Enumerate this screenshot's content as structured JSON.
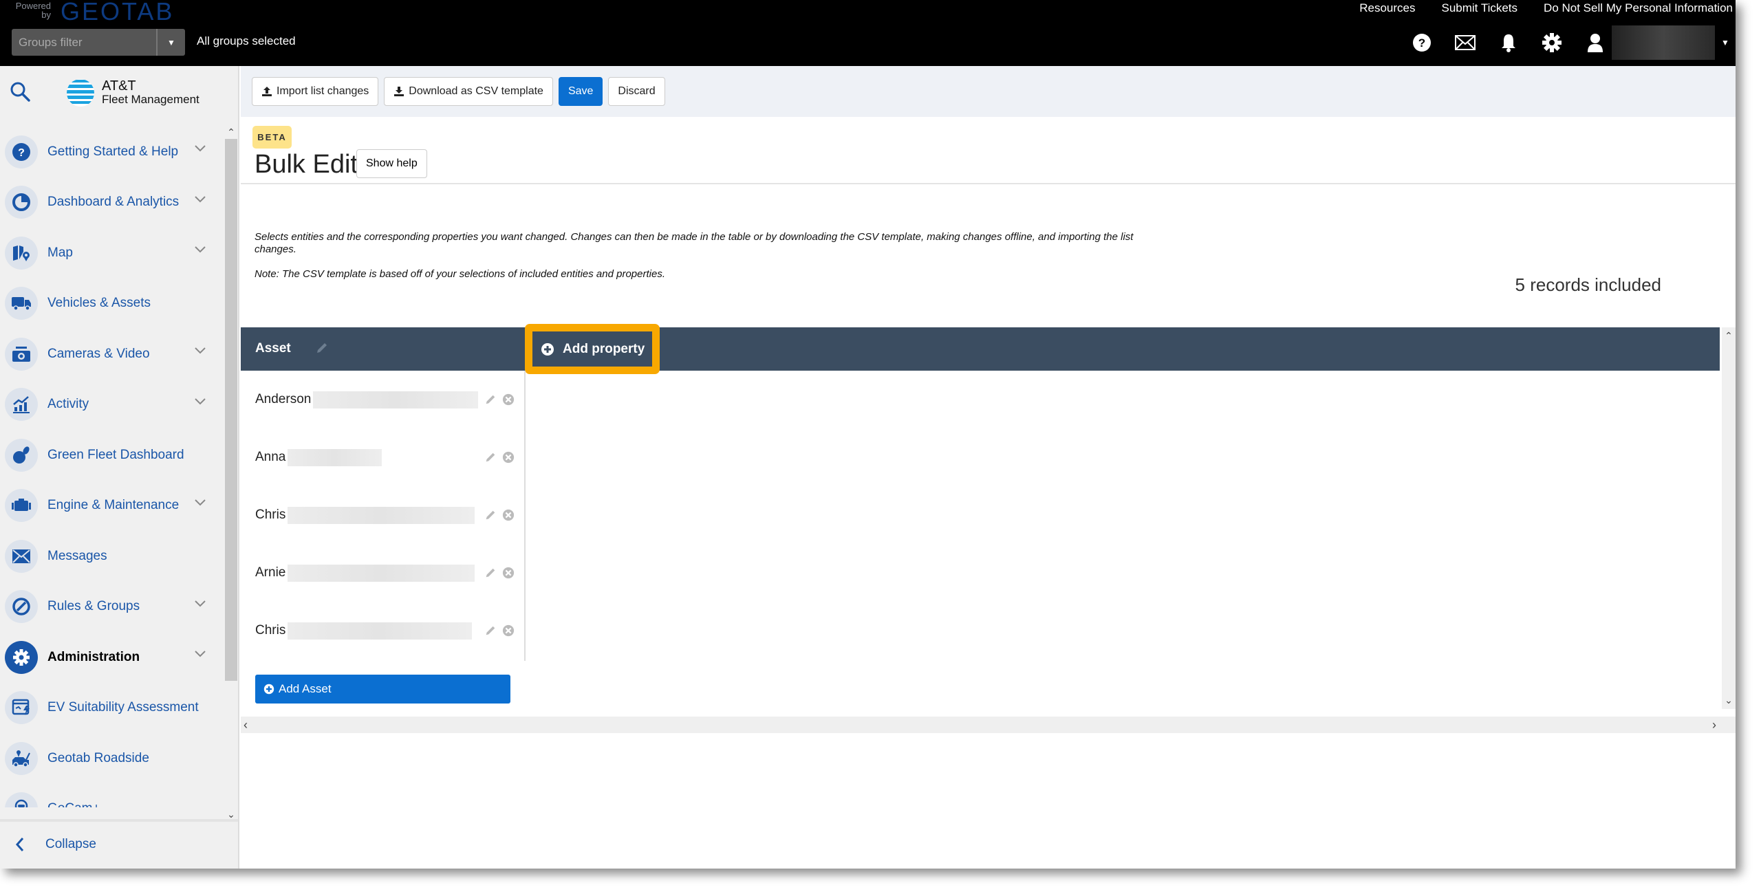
{
  "topbar": {
    "powered_by": "Powered by",
    "brand": "GEOTAB",
    "links": [
      "Resources",
      "Submit Tickets",
      "Do Not Sell My Personal Information"
    ],
    "groups_filter_placeholder": "Groups filter",
    "groups_status": "All groups selected",
    "icons": [
      "help-icon",
      "mail-icon",
      "bell-icon",
      "gear-icon",
      "user-icon"
    ]
  },
  "sidebar": {
    "logo_line1": "AT&T",
    "logo_line2": "Fleet Management",
    "items": [
      {
        "label": "Getting Started & Help",
        "icon": "help-icon",
        "expandable": true
      },
      {
        "label": "Dashboard & Analytics",
        "icon": "pie-chart-icon",
        "expandable": true
      },
      {
        "label": "Map",
        "icon": "map-icon",
        "expandable": true
      },
      {
        "label": "Vehicles & Assets",
        "icon": "truck-icon",
        "expandable": false
      },
      {
        "label": "Cameras & Video",
        "icon": "camera-icon",
        "expandable": true
      },
      {
        "label": "Activity",
        "icon": "activity-chart-icon",
        "expandable": true
      },
      {
        "label": "Green Fleet Dashboard",
        "icon": "leaf-icon",
        "expandable": false
      },
      {
        "label": "Engine & Maintenance",
        "icon": "engine-icon",
        "expandable": true
      },
      {
        "label": "Messages",
        "icon": "envelope-icon",
        "expandable": false
      },
      {
        "label": "Rules & Groups",
        "icon": "rules-icon",
        "expandable": true
      },
      {
        "label": "Administration",
        "icon": "gear-icon",
        "expandable": true,
        "active": true
      },
      {
        "label": "EV Suitability Assessment",
        "icon": "ev-icon",
        "expandable": false
      },
      {
        "label": "Geotab Roadside",
        "icon": "tow-truck-icon",
        "expandable": false
      },
      {
        "label": "GoCam+",
        "icon": "gocam-icon",
        "expandable": false
      }
    ],
    "collapse_label": "Collapse"
  },
  "toolbar": {
    "import_label": "Import list changes",
    "download_label": "Download as CSV template",
    "save_label": "Save",
    "discard_label": "Discard"
  },
  "page": {
    "badge": "BETA",
    "title": "Bulk Edit",
    "show_help_label": "Show help",
    "description": "Selects entities and the corresponding properties you want changed. Changes can then be made in the table or by downloading the CSV template, making changes offline, and importing the list changes.",
    "note": "Note: The CSV template is based off of your selections of included entities and properties.",
    "records_count": "5 records included"
  },
  "grid": {
    "column_header": "Asset",
    "add_property_label": "Add property",
    "rows": [
      {
        "name": "Anderson"
      },
      {
        "name": "Anna"
      },
      {
        "name": "Chris"
      },
      {
        "name": "Arnie"
      },
      {
        "name": "Chris"
      }
    ],
    "add_asset_label": "Add Asset"
  },
  "colors": {
    "accent_blue": "#0b6fd1",
    "nav_blue": "#1a56a8",
    "grid_header": "#3b4d61",
    "highlight": "#f8a800",
    "beta_badge": "#fde38a"
  }
}
